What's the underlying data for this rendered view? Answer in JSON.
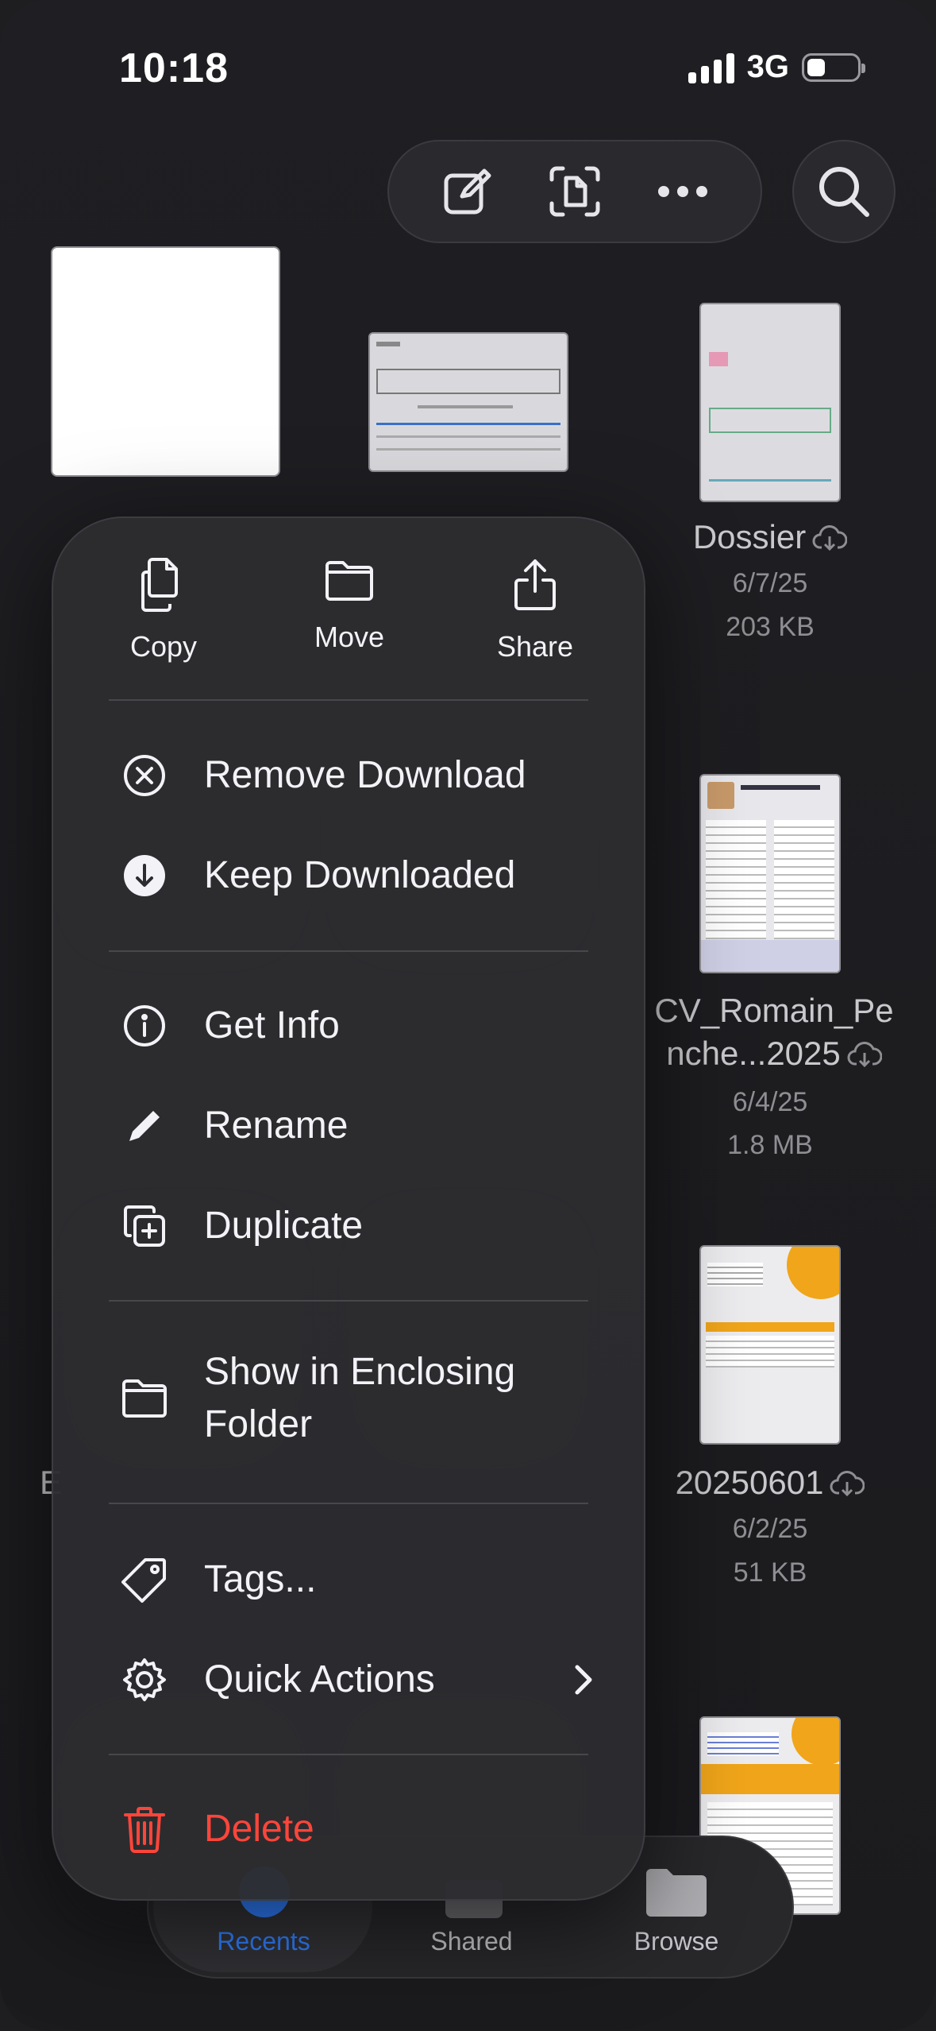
{
  "status_bar": {
    "time": "10:18",
    "network": "3G"
  },
  "toolbar": {
    "compose": "compose-icon",
    "scan": "scan-document-icon",
    "more": "more-icon",
    "search": "search-icon"
  },
  "files": [
    {
      "name": "Dossier",
      "date": "6/7/25",
      "size": "203 KB"
    },
    {
      "name_line1": "CV_Romain_Pe",
      "name_line2": "nche...2025",
      "date": "6/4/25",
      "size": "1.8 MB"
    },
    {
      "name": "20250601",
      "date": "6/2/25",
      "size": "51 KB"
    }
  ],
  "partial_label": "E",
  "context_menu": {
    "quick_actions": [
      {
        "label": "Copy",
        "icon": "copy-icon"
      },
      {
        "label": "Move",
        "icon": "folder-icon"
      },
      {
        "label": "Share",
        "icon": "share-icon"
      }
    ],
    "download_group": [
      {
        "label": "Remove Download",
        "icon": "x-circle-icon"
      },
      {
        "label": "Keep Downloaded",
        "icon": "download-circle-icon"
      }
    ],
    "info_group": [
      {
        "label": "Get Info",
        "icon": "info-icon"
      },
      {
        "label": "Rename",
        "icon": "pencil-icon"
      },
      {
        "label": "Duplicate",
        "icon": "duplicate-icon"
      }
    ],
    "enclosing": {
      "line1": "Show in Enclosing",
      "line2": "Folder",
      "icon": "folder-icon"
    },
    "tags_group": [
      {
        "label": "Tags...",
        "icon": "tag-icon"
      },
      {
        "label": "Quick Actions",
        "icon": "gear-icon"
      }
    ],
    "delete": {
      "label": "Delete",
      "icon": "trash-icon",
      "color": "#ff453a"
    }
  },
  "tab_bar": {
    "tabs": [
      {
        "label": "Recents",
        "active": true,
        "color": "#2f7fff"
      },
      {
        "label": "Shared",
        "active": false
      },
      {
        "label": "Browse",
        "active": false
      }
    ]
  }
}
